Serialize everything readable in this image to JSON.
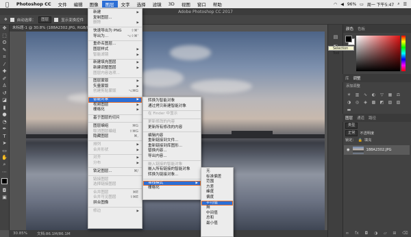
{
  "mac_menubar": {
    "items": [
      "Photoshop CC",
      "文件",
      "编辑",
      "图像",
      "图层",
      "文字",
      "选择",
      "滤镜",
      "3D",
      "视图",
      "窗口",
      "帮助"
    ],
    "active_index": 4,
    "battery": "96%",
    "clock": "周一 下午5:47"
  },
  "window": {
    "title": "Adobe Photoshop CC 2017"
  },
  "options_bar": {
    "auto_select_label": "自动选择：",
    "auto_select_value": "图层",
    "transform_label": "显示变换控件"
  },
  "document_tab": "未标题-1 @ 30.8% (188A2302.JPG, RGB/8)",
  "status_bar": {
    "zoom": "30.85%",
    "doc_info": "文档:86.1M/86.1M"
  },
  "tooltip": "Selection Tool",
  "panels": {
    "color_tabs": [
      "颜色",
      "色板"
    ],
    "adjust_tabs": [
      "库",
      "调整"
    ],
    "adjust_title": "添加调整",
    "layers_tabs": [
      "图层",
      "通道",
      "路径"
    ],
    "kind_label": "类型",
    "blend_mode": "正常",
    "opacity_label": "不透明度",
    "lock_label": "锁定：",
    "fill_label": "填充",
    "layer_name": "188A2302.JPG"
  },
  "layer_menu": {
    "items": [
      {
        "label": "新建",
        "arrow": true
      },
      {
        "label": "复制图层..."
      },
      {
        "label": "删除",
        "arrow": true,
        "disabled": true
      },
      {
        "sep": true
      },
      {
        "label": "快速导出为 PNG",
        "shortcut": "⇧⌘'"
      },
      {
        "label": "导出为...",
        "shortcut": "⌥⇧⌘'"
      },
      {
        "sep": true
      },
      {
        "label": "重命名图层..."
      },
      {
        "label": "图层样式",
        "arrow": true
      },
      {
        "label": "智能滤镜",
        "arrow": true,
        "disabled": true
      },
      {
        "sep": true
      },
      {
        "label": "新建填充图层",
        "arrow": true
      },
      {
        "label": "新建调整图层",
        "arrow": true
      },
      {
        "label": "图层内容选项...",
        "disabled": true
      },
      {
        "sep": true
      },
      {
        "label": "图层蒙版",
        "arrow": true
      },
      {
        "label": "矢量蒙版",
        "arrow": true
      },
      {
        "label": "创建剪贴蒙版",
        "shortcut": "⌥⌘G",
        "disabled": true
      },
      {
        "sep": true
      },
      {
        "label": "智能对象",
        "arrow": true,
        "highlight": true,
        "ring": true
      },
      {
        "label": "视频图层",
        "arrow": true
      },
      {
        "label": "栅格化",
        "arrow": true
      },
      {
        "sep": true
      },
      {
        "label": "基于图层的切片"
      },
      {
        "sep": true
      },
      {
        "label": "图层编组",
        "shortcut": "⌘G"
      },
      {
        "label": "取消图层编组",
        "shortcut": "⇧⌘G",
        "disabled": true
      },
      {
        "label": "隐藏图层",
        "shortcut": "⌘,"
      },
      {
        "sep": true
      },
      {
        "label": "排列",
        "arrow": true,
        "disabled": true
      },
      {
        "label": "合并形状",
        "arrow": true,
        "disabled": true
      },
      {
        "sep": true
      },
      {
        "label": "对齐",
        "arrow": true,
        "disabled": true
      },
      {
        "label": "分布",
        "arrow": true,
        "disabled": true
      },
      {
        "sep": true
      },
      {
        "label": "锁定图层...",
        "shortcut": "⌘/"
      },
      {
        "sep": true
      },
      {
        "label": "链接图层",
        "disabled": true
      },
      {
        "label": "选择链接图层",
        "disabled": true
      },
      {
        "sep": true
      },
      {
        "label": "合并图层",
        "shortcut": "⌘E",
        "disabled": true
      },
      {
        "label": "合并可见图层",
        "shortcut": "⇧⌘E",
        "disabled": true
      },
      {
        "label": "拼合图像"
      },
      {
        "sep": true
      },
      {
        "label": "修边",
        "arrow": true,
        "disabled": true
      }
    ]
  },
  "smart_object_menu": {
    "items": [
      {
        "label": "转换为智能对象"
      },
      {
        "label": "通过拷贝新建智能对象"
      },
      {
        "sep": true
      },
      {
        "label": "在 Finder 中显示",
        "disabled": true
      },
      {
        "sep": true
      },
      {
        "label": "更新修改的内容",
        "disabled": true
      },
      {
        "label": "更新所有修改的内容"
      },
      {
        "sep": true
      },
      {
        "label": "编辑内容"
      },
      {
        "label": "重新链接到文件..."
      },
      {
        "label": "重新链接到库图形..."
      },
      {
        "label": "替换内容..."
      },
      {
        "label": "导出内容..."
      },
      {
        "sep": true
      },
      {
        "label": "嵌入链接的智能对象",
        "disabled": true
      },
      {
        "label": "嵌入所有链接的智能对象"
      },
      {
        "label": "转换为链接对象..."
      },
      {
        "sep": true
      },
      {
        "label": "堆栈模式",
        "arrow": true,
        "highlight": true,
        "ring": true
      },
      {
        "label": "栅格化"
      }
    ]
  },
  "stack_mode_menu": {
    "items": [
      {
        "label": "无"
      },
      {
        "label": "标准偏差"
      },
      {
        "label": "范围"
      },
      {
        "label": "方差"
      },
      {
        "label": "峰度"
      },
      {
        "label": "偏度"
      },
      {
        "label": "平均值",
        "highlight": true,
        "ring": true
      },
      {
        "label": "熵"
      },
      {
        "label": "中间值"
      },
      {
        "label": "总和"
      },
      {
        "label": "最小值"
      }
    ]
  },
  "colors": {
    "accent": "#2c6fd6",
    "ring": "#e8702a",
    "menu_bg": "#ececec",
    "panel_bg": "#424242"
  }
}
